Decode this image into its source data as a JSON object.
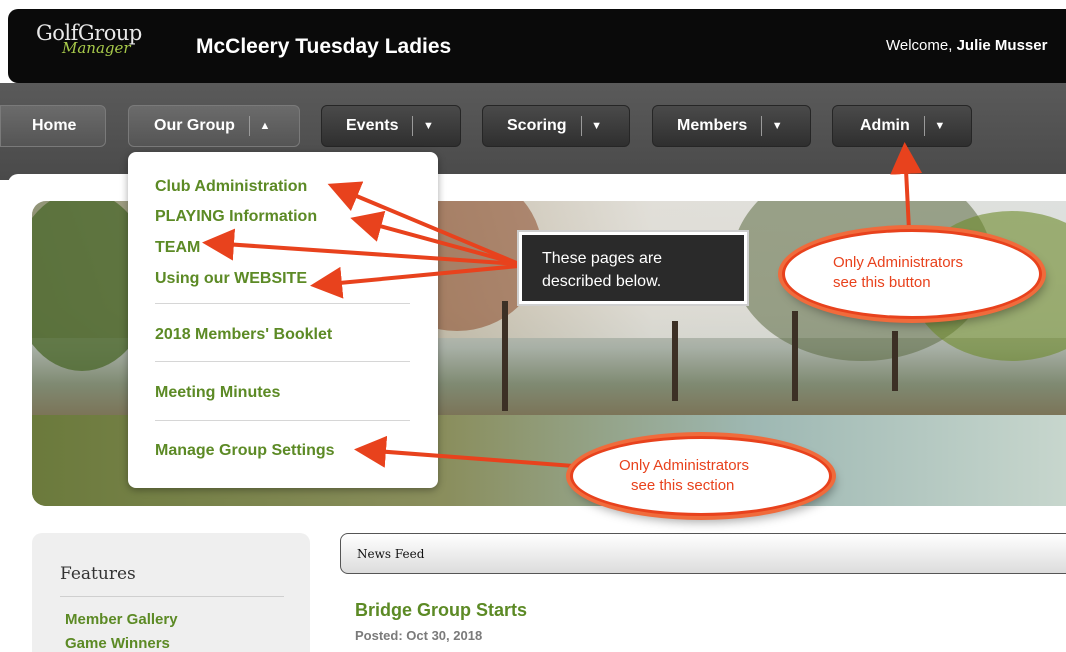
{
  "header": {
    "logo_main": "GolfGroup",
    "logo_sub": "Manager",
    "group_title": "McCleery Tuesday Ladies",
    "welcome_prefix": "Welcome, ",
    "welcome_name": "Julie Musser"
  },
  "nav": {
    "home": "Home",
    "our_group": "Our Group",
    "events": "Events",
    "scoring": "Scoring",
    "members": "Members",
    "admin": "Admin",
    "caret_up": "▲",
    "caret_down": "▼"
  },
  "dropdown": {
    "items": [
      "Club Administration",
      "PLAYING Information",
      "TEAM",
      "Using our WEBSITE",
      "2018 Members' Booklet",
      "Meeting Minutes",
      "Manage Group Settings"
    ]
  },
  "annotations": {
    "pages_line1": "These pages are",
    "pages_line2": "described below.",
    "admin_button_line1": "Only Administrators",
    "admin_button_line2": "see this button",
    "admin_section_line1": "Only Administrators",
    "admin_section_line2": "see this section",
    "accent_color": "#e8421d"
  },
  "sidebar": {
    "title": "Features",
    "links": [
      "Member Gallery",
      "Game Winners"
    ]
  },
  "newsfeed": {
    "label": "News Feed",
    "post_title": "Bridge Group Starts",
    "post_date": "Posted: Oct 30, 2018"
  },
  "colors": {
    "link_green": "#5c8a25",
    "header_bg": "#0a0a0a"
  }
}
